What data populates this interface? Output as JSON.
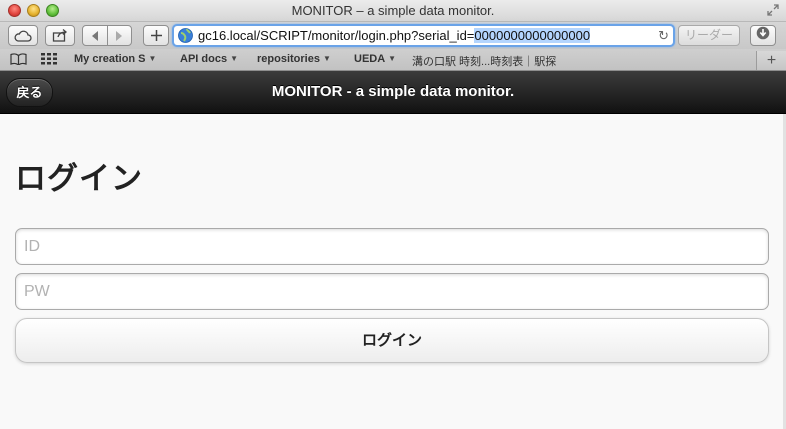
{
  "window": {
    "title": "MONITOR – a simple data monitor."
  },
  "toolbar": {
    "url_prefix": "gc16.local/SCRIPT/monitor/login.php?serial_id=",
    "url_selected": "0000000000000000",
    "reader_label": "リーダー"
  },
  "bookmarks": [
    {
      "label": "My creation S",
      "has_menu": true
    },
    {
      "label": "API docs",
      "has_menu": true
    },
    {
      "label": "repositories",
      "has_menu": true
    },
    {
      "label": "UEDA",
      "has_menu": true
    },
    {
      "label": "溝の口駅 時刻...時刻表｜駅探",
      "has_menu": false
    }
  ],
  "header": {
    "back_label": "戻る",
    "title": "MONITOR - a simple data monitor."
  },
  "main": {
    "heading": "ログイン",
    "id_placeholder": "ID",
    "pw_placeholder": "PW",
    "login_button": "ログイン"
  }
}
